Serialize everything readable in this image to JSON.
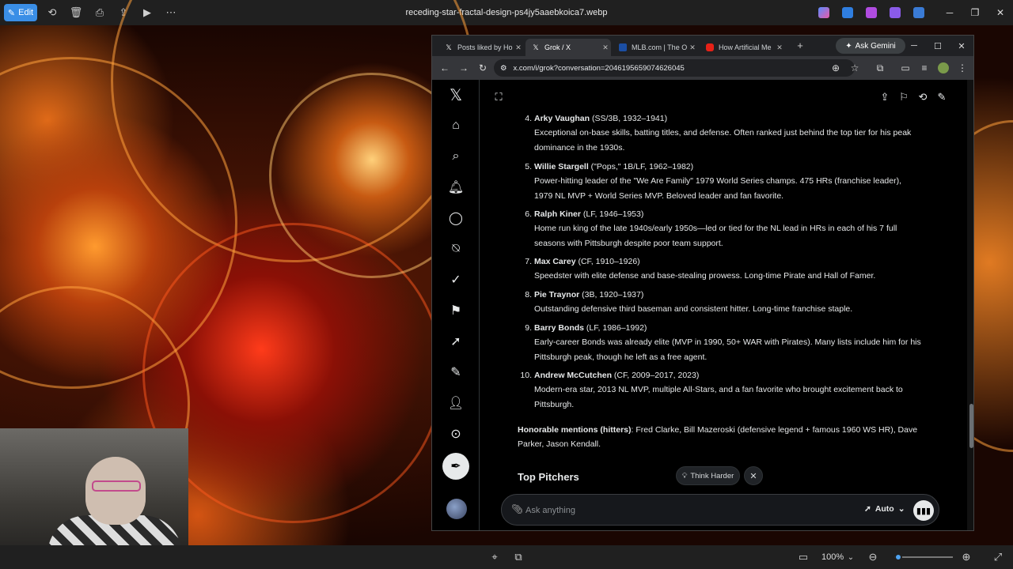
{
  "viewer": {
    "edit_label": "Edit",
    "file_title": "receding-star-fractal-design-ps4jy5aaebkoica7.webp",
    "zoom": "100%"
  },
  "browser": {
    "tabs": [
      {
        "label": "Posts liked by Ho",
        "icon": "x-logo-icon"
      },
      {
        "label": "Grok / X",
        "icon": "x-logo-icon",
        "active": true
      },
      {
        "label": "MLB.com | The Of",
        "icon": "mlb-icon"
      },
      {
        "label": "How Artificial Me",
        "icon": "youtube-icon"
      }
    ],
    "gemini_label": "Ask Gemini",
    "url": "x.com/i/grok?conversation=2046195659074626045"
  },
  "chat": {
    "items": [
      {
        "num": "4.",
        "name": "Arky Vaughan",
        "meta": " (SS/3B, 1932–1941)",
        "desc": "Exceptional on-base skills, batting titles, and defense. Often ranked just behind the top tier for his peak dominance in the 1930s."
      },
      {
        "num": "5.",
        "name": "Willie Stargell",
        "meta": " (\"Pops,\" 1B/LF, 1962–1982)",
        "desc": "Power-hitting leader of the \"We Are Family\" 1979 World Series champs. 475 HRs (franchise leader), 1979 NL MVP + World Series MVP. Beloved leader and fan favorite."
      },
      {
        "num": "6.",
        "name": "Ralph Kiner",
        "meta": " (LF, 1946–1953)",
        "desc": "Home run king of the late 1940s/early 1950s—led or tied for the NL lead in HRs in each of his 7 full seasons with Pittsburgh despite poor team support."
      },
      {
        "num": "7.",
        "name": "Max Carey",
        "meta": " (CF, 1910–1926)",
        "desc": "Speedster with elite defense and base-stealing prowess. Long-time Pirate and Hall of Famer."
      },
      {
        "num": "8.",
        "name": "Pie Traynor",
        "meta": " (3B, 1920–1937)",
        "desc": "Outstanding defensive third baseman and consistent hitter. Long-time franchise staple."
      },
      {
        "num": "9.",
        "name": "Barry Bonds",
        "meta": " (LF, 1986–1992)",
        "desc": "Early-career Bonds was already elite (MVP in 1990, 50+ WAR with Pirates). Many lists include him for his Pittsburgh peak, though he left as a free agent."
      },
      {
        "num": "10.",
        "name": "Andrew McCutchen",
        "meta": " (CF, 2009–2017, 2023)",
        "desc": "Modern-era star, 2013 NL MVP, multiple All-Stars, and a fan favorite who brought excitement back to Pittsburgh."
      }
    ],
    "honorable_label": "Honorable mentions (hitters)",
    "honorable_text": ": Fred Clarke, Bill Mazeroski (defensive legend + famous 1960 WS HR), Dave Parker, Jason Kendall.",
    "section_title": "Top Pitchers",
    "think_harder": "Think Harder",
    "ask_placeholder": "Ask anything",
    "mode": "Auto"
  }
}
